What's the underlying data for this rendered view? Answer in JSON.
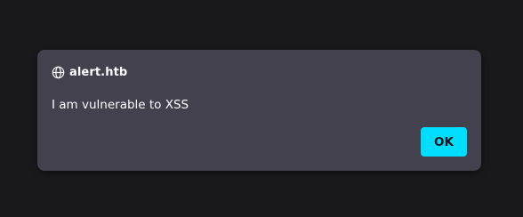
{
  "dialog": {
    "icon": "globe-icon",
    "title": "alert.htb",
    "message": "I am vulnerable to XSS",
    "ok_label": "OK"
  },
  "colors": {
    "background": "#19181b",
    "dialog_bg": "#42414d",
    "text": "#fbfbfe",
    "accent": "#00ddff",
    "button_text": "#15141a"
  }
}
